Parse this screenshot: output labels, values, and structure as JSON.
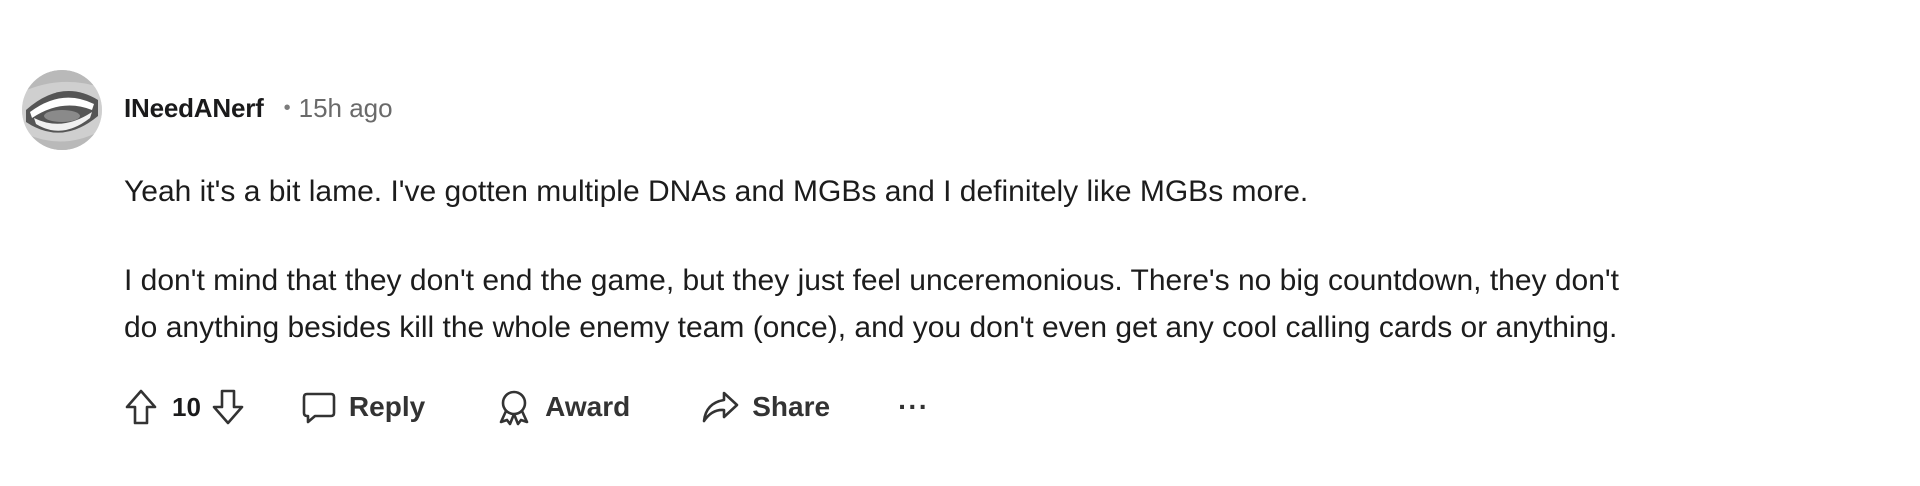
{
  "comment": {
    "author": "INeedANerf",
    "separator": "•",
    "timestamp": "15h ago",
    "paragraphs": [
      "Yeah it's a bit lame. I've gotten multiple DNAs and MGBs and I definitely like MGBs more.",
      "I don't mind that they don't end the game, but they just feel unceremonious. There's no big countdown, they don't",
      "do anything besides kill the whole enemy team (once), and you don't even get any cool calling cards or anything."
    ],
    "score": "10",
    "actions": {
      "reply_label": "Reply",
      "award_label": "Award",
      "share_label": "Share",
      "more_label": "···"
    },
    "icons": {
      "avatar": "avatar-image",
      "upvote": "upvote-arrow-icon",
      "downvote": "downvote-arrow-icon",
      "reply": "speech-bubble-icon",
      "award": "award-ribbon-icon",
      "share": "share-arrow-icon",
      "more": "more-options-icon"
    },
    "colors": {
      "text": "#1a1a1b",
      "muted": "#6a6a6a",
      "icon": "#333333"
    }
  }
}
